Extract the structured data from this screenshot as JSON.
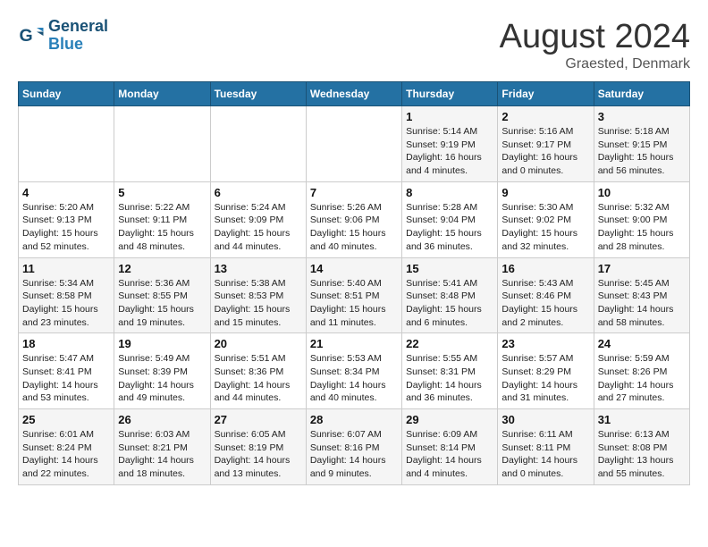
{
  "header": {
    "logo_line1": "General",
    "logo_line2": "Blue",
    "title": "August 2024",
    "subtitle": "Graested, Denmark"
  },
  "days_of_week": [
    "Sunday",
    "Monday",
    "Tuesday",
    "Wednesday",
    "Thursday",
    "Friday",
    "Saturday"
  ],
  "weeks": [
    [
      {
        "num": "",
        "info": ""
      },
      {
        "num": "",
        "info": ""
      },
      {
        "num": "",
        "info": ""
      },
      {
        "num": "",
        "info": ""
      },
      {
        "num": "1",
        "info": "Sunrise: 5:14 AM\nSunset: 9:19 PM\nDaylight: 16 hours\nand 4 minutes."
      },
      {
        "num": "2",
        "info": "Sunrise: 5:16 AM\nSunset: 9:17 PM\nDaylight: 16 hours\nand 0 minutes."
      },
      {
        "num": "3",
        "info": "Sunrise: 5:18 AM\nSunset: 9:15 PM\nDaylight: 15 hours\nand 56 minutes."
      }
    ],
    [
      {
        "num": "4",
        "info": "Sunrise: 5:20 AM\nSunset: 9:13 PM\nDaylight: 15 hours\nand 52 minutes."
      },
      {
        "num": "5",
        "info": "Sunrise: 5:22 AM\nSunset: 9:11 PM\nDaylight: 15 hours\nand 48 minutes."
      },
      {
        "num": "6",
        "info": "Sunrise: 5:24 AM\nSunset: 9:09 PM\nDaylight: 15 hours\nand 44 minutes."
      },
      {
        "num": "7",
        "info": "Sunrise: 5:26 AM\nSunset: 9:06 PM\nDaylight: 15 hours\nand 40 minutes."
      },
      {
        "num": "8",
        "info": "Sunrise: 5:28 AM\nSunset: 9:04 PM\nDaylight: 15 hours\nand 36 minutes."
      },
      {
        "num": "9",
        "info": "Sunrise: 5:30 AM\nSunset: 9:02 PM\nDaylight: 15 hours\nand 32 minutes."
      },
      {
        "num": "10",
        "info": "Sunrise: 5:32 AM\nSunset: 9:00 PM\nDaylight: 15 hours\nand 28 minutes."
      }
    ],
    [
      {
        "num": "11",
        "info": "Sunrise: 5:34 AM\nSunset: 8:58 PM\nDaylight: 15 hours\nand 23 minutes."
      },
      {
        "num": "12",
        "info": "Sunrise: 5:36 AM\nSunset: 8:55 PM\nDaylight: 15 hours\nand 19 minutes."
      },
      {
        "num": "13",
        "info": "Sunrise: 5:38 AM\nSunset: 8:53 PM\nDaylight: 15 hours\nand 15 minutes."
      },
      {
        "num": "14",
        "info": "Sunrise: 5:40 AM\nSunset: 8:51 PM\nDaylight: 15 hours\nand 11 minutes."
      },
      {
        "num": "15",
        "info": "Sunrise: 5:41 AM\nSunset: 8:48 PM\nDaylight: 15 hours\nand 6 minutes."
      },
      {
        "num": "16",
        "info": "Sunrise: 5:43 AM\nSunset: 8:46 PM\nDaylight: 15 hours\nand 2 minutes."
      },
      {
        "num": "17",
        "info": "Sunrise: 5:45 AM\nSunset: 8:43 PM\nDaylight: 14 hours\nand 58 minutes."
      }
    ],
    [
      {
        "num": "18",
        "info": "Sunrise: 5:47 AM\nSunset: 8:41 PM\nDaylight: 14 hours\nand 53 minutes."
      },
      {
        "num": "19",
        "info": "Sunrise: 5:49 AM\nSunset: 8:39 PM\nDaylight: 14 hours\nand 49 minutes."
      },
      {
        "num": "20",
        "info": "Sunrise: 5:51 AM\nSunset: 8:36 PM\nDaylight: 14 hours\nand 44 minutes."
      },
      {
        "num": "21",
        "info": "Sunrise: 5:53 AM\nSunset: 8:34 PM\nDaylight: 14 hours\nand 40 minutes."
      },
      {
        "num": "22",
        "info": "Sunrise: 5:55 AM\nSunset: 8:31 PM\nDaylight: 14 hours\nand 36 minutes."
      },
      {
        "num": "23",
        "info": "Sunrise: 5:57 AM\nSunset: 8:29 PM\nDaylight: 14 hours\nand 31 minutes."
      },
      {
        "num": "24",
        "info": "Sunrise: 5:59 AM\nSunset: 8:26 PM\nDaylight: 14 hours\nand 27 minutes."
      }
    ],
    [
      {
        "num": "25",
        "info": "Sunrise: 6:01 AM\nSunset: 8:24 PM\nDaylight: 14 hours\nand 22 minutes."
      },
      {
        "num": "26",
        "info": "Sunrise: 6:03 AM\nSunset: 8:21 PM\nDaylight: 14 hours\nand 18 minutes."
      },
      {
        "num": "27",
        "info": "Sunrise: 6:05 AM\nSunset: 8:19 PM\nDaylight: 14 hours\nand 13 minutes."
      },
      {
        "num": "28",
        "info": "Sunrise: 6:07 AM\nSunset: 8:16 PM\nDaylight: 14 hours\nand 9 minutes."
      },
      {
        "num": "29",
        "info": "Sunrise: 6:09 AM\nSunset: 8:14 PM\nDaylight: 14 hours\nand 4 minutes."
      },
      {
        "num": "30",
        "info": "Sunrise: 6:11 AM\nSunset: 8:11 PM\nDaylight: 14 hours\nand 0 minutes."
      },
      {
        "num": "31",
        "info": "Sunrise: 6:13 AM\nSunset: 8:08 PM\nDaylight: 13 hours\nand 55 minutes."
      }
    ]
  ]
}
